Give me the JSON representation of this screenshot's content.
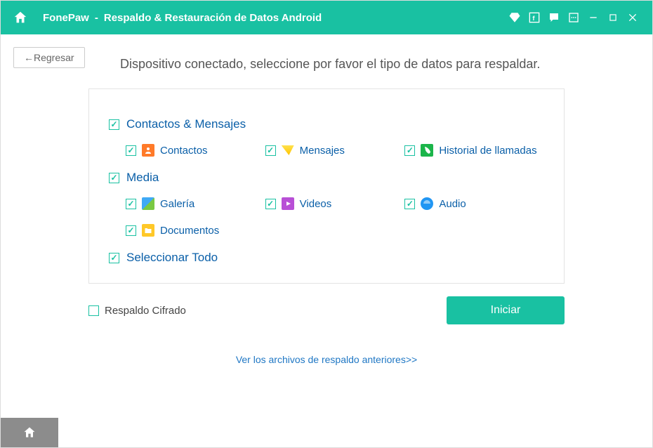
{
  "titlebar": {
    "app": "FonePaw",
    "separator": "-",
    "subtitle": "Respaldo & Restauración de Datos Android"
  },
  "back_button": "←Regresar",
  "instruction": "Dispositivo conectado, seleccione por favor el tipo de datos para respaldar.",
  "groups": [
    {
      "label": "Contactos & Mensajes",
      "checked": true,
      "items": [
        {
          "label": "Contactos",
          "icon": "contacts",
          "checked": true
        },
        {
          "label": "Mensajes",
          "icon": "messages",
          "checked": true
        },
        {
          "label": "Historial de llamadas",
          "icon": "calls",
          "checked": true
        }
      ]
    },
    {
      "label": "Media",
      "checked": true,
      "items": [
        {
          "label": "Galería",
          "icon": "gallery",
          "checked": true
        },
        {
          "label": "Videos",
          "icon": "videos",
          "checked": true
        },
        {
          "label": "Audio",
          "icon": "audio",
          "checked": true
        },
        {
          "label": "Documentos",
          "icon": "docs",
          "checked": true
        }
      ]
    }
  ],
  "select_all": {
    "label": "Seleccionar Todo",
    "checked": true
  },
  "encrypted": {
    "label": "Respaldo Cifrado",
    "checked": false
  },
  "start_button": "Iniciar",
  "link_previous": "Ver los archivos de respaldo anteriores>>"
}
